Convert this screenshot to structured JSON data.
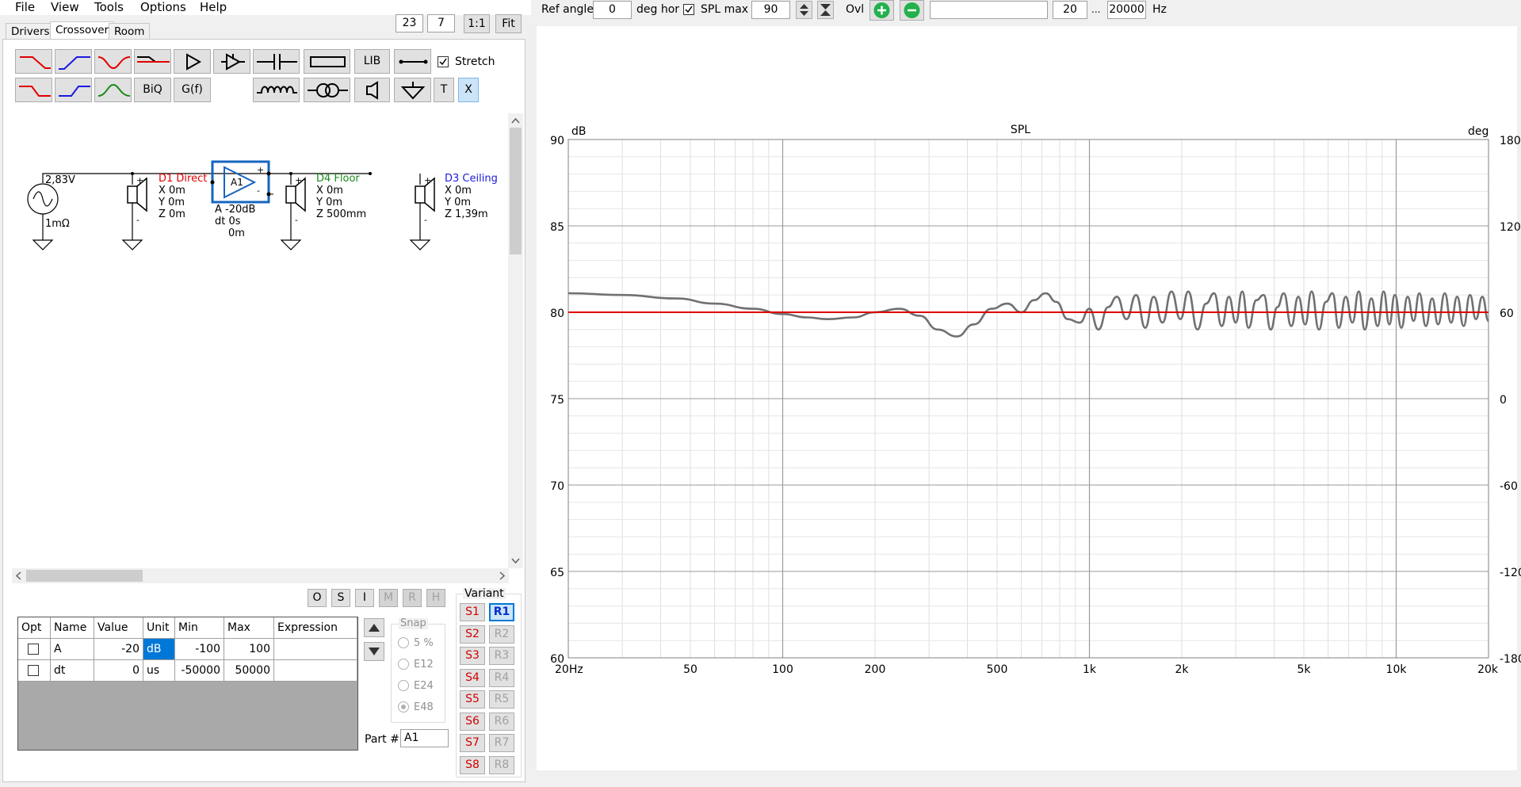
{
  "menu": [
    "File",
    "View",
    "Tools",
    "Options",
    "Help"
  ],
  "toolbar_left": {
    "value1": "23",
    "value2": "7",
    "btn_1to1": "1:1",
    "btn_fit": "Fit"
  },
  "tabs": [
    "Drivers",
    "Crossover",
    "Room"
  ],
  "tools": {
    "lib": "LIB",
    "biq": "BiQ",
    "gf": "G(f)",
    "t": "T",
    "x": "X",
    "stretch": "Stretch"
  },
  "schematic": {
    "source": {
      "voltage": "2,83V",
      "impedance": "1mΩ"
    },
    "d1": {
      "name": "D1 Direct",
      "x": "X 0m",
      "y": "Y 0m",
      "z": "Z 0m",
      "color": "#e00000"
    },
    "amp": {
      "label": "A1",
      "gain": "A  -20dB",
      "dt": "dt 0s",
      "dist": "0m",
      "color": "#1565c0"
    },
    "d4": {
      "name": "D4 Floor",
      "x": "X 0m",
      "y": "Y 0m",
      "z": "Z 500mm",
      "color": "#1a8a1a"
    },
    "d3": {
      "name": "D3 Ceiling",
      "x": "X 0m",
      "y": "Y 0m",
      "z": "Z 1,39m",
      "color": "#1a1ae0"
    }
  },
  "osi_buttons": [
    "O",
    "S",
    "I",
    "M",
    "R",
    "H"
  ],
  "table": {
    "headers": [
      "Opt",
      "Name",
      "Value",
      "Unit",
      "Min",
      "Max",
      "Expression"
    ],
    "rows": [
      {
        "name": "A",
        "value": "-20",
        "unit": "dB",
        "min": "-100",
        "max": "100",
        "expression": ""
      },
      {
        "name": "dt",
        "value": "0",
        "unit": "us",
        "min": "-50000",
        "max": "50000",
        "expression": ""
      }
    ]
  },
  "snap": {
    "label": "Snap",
    "options": [
      "5 %",
      "E12",
      "E24",
      "E48"
    ],
    "selected": "E48"
  },
  "part": {
    "label": "Part #",
    "value": "A1"
  },
  "variant": {
    "label": "Variant",
    "s": [
      "S1",
      "S2",
      "S3",
      "S4",
      "S5",
      "S6",
      "S7",
      "S8"
    ],
    "r": [
      "R1",
      "R2",
      "R3",
      "R4",
      "R5",
      "R6",
      "R7",
      "R8"
    ],
    "selected": "R1"
  },
  "top_bar": {
    "ref_angle_label": "Ref angle",
    "ref_angle": "0",
    "deg_hor": "deg hor",
    "spl_max_label": "SPL max",
    "spl_max": "90",
    "ovl": "Ovl",
    "text_field": "",
    "f_min": "20",
    "ellipsis": "...",
    "f_max": "20000",
    "hz": "Hz"
  },
  "chart_data": {
    "type": "line",
    "title": "SPL",
    "xlabel": "Hz",
    "ylabel": "dB",
    "y2label": "deg",
    "x_scale": "log",
    "xlim": [
      20,
      20000
    ],
    "ylim": [
      60,
      90
    ],
    "y2lim": [
      -180,
      180
    ],
    "x_ticks": [
      20,
      50,
      100,
      200,
      500,
      1000,
      2000,
      5000,
      10000,
      20000
    ],
    "x_tick_labels": [
      "20Hz",
      "50",
      "100",
      "200",
      "500",
      "1k",
      "2k",
      "5k",
      "10k",
      "20k"
    ],
    "y_ticks": [
      90,
      85,
      80,
      75,
      70,
      65,
      60
    ],
    "y2_ticks": [
      180,
      120,
      60,
      0,
      -60,
      -120,
      -180
    ],
    "grid": true,
    "series": [
      {
        "color": "#707070",
        "x": [
          20,
          30,
          45,
          60,
          80,
          100,
          120,
          140,
          170,
          200,
          240,
          280,
          320,
          370,
          420,
          480,
          540,
          600,
          660,
          720,
          780,
          850,
          930,
          1000,
          1070,
          1150,
          1230,
          1320,
          1420,
          1520,
          1620,
          1730,
          1850,
          1980,
          2100,
          2250,
          2400,
          2550,
          2700,
          2850,
          3000,
          3150,
          3300,
          3500,
          3700,
          3900,
          4100,
          4300,
          4550,
          4800,
          5050,
          5300,
          5600,
          5900,
          6200,
          6500,
          6850,
          7200,
          7550,
          7900,
          8300,
          8700,
          9100,
          9500,
          9900,
          10400,
          10900,
          11400,
          11900,
          12500,
          13100,
          13700,
          14400,
          15100,
          15800,
          16600,
          17400,
          18200,
          19100,
          20000
        ],
        "y": [
          81.1,
          81.0,
          80.8,
          80.5,
          80.2,
          79.9,
          79.7,
          79.6,
          79.7,
          80.0,
          80.2,
          79.8,
          79.0,
          78.6,
          79.3,
          80.2,
          80.5,
          80.0,
          80.7,
          81.1,
          80.6,
          79.6,
          79.4,
          80.2,
          79.0,
          80.3,
          80.9,
          79.6,
          81.0,
          79.1,
          80.9,
          79.4,
          81.2,
          79.6,
          81.2,
          79.0,
          80.5,
          81.1,
          79.2,
          80.9,
          79.4,
          81.2,
          79.1,
          80.7,
          81.0,
          79.0,
          80.3,
          81.1,
          79.2,
          80.9,
          79.3,
          81.2,
          79.0,
          80.6,
          81.1,
          79.1,
          80.9,
          79.4,
          81.2,
          79.0,
          80.8,
          79.2,
          81.2,
          79.3,
          81.0,
          79.1,
          80.9,
          79.5,
          81.1,
          79.2,
          80.8,
          79.3,
          81.1,
          79.4,
          80.9,
          79.2,
          81.0,
          79.6,
          80.9,
          79.5
        ]
      },
      {
        "color": "#e00000",
        "x": [
          20,
          20000
        ],
        "y": [
          80,
          80
        ]
      }
    ]
  }
}
